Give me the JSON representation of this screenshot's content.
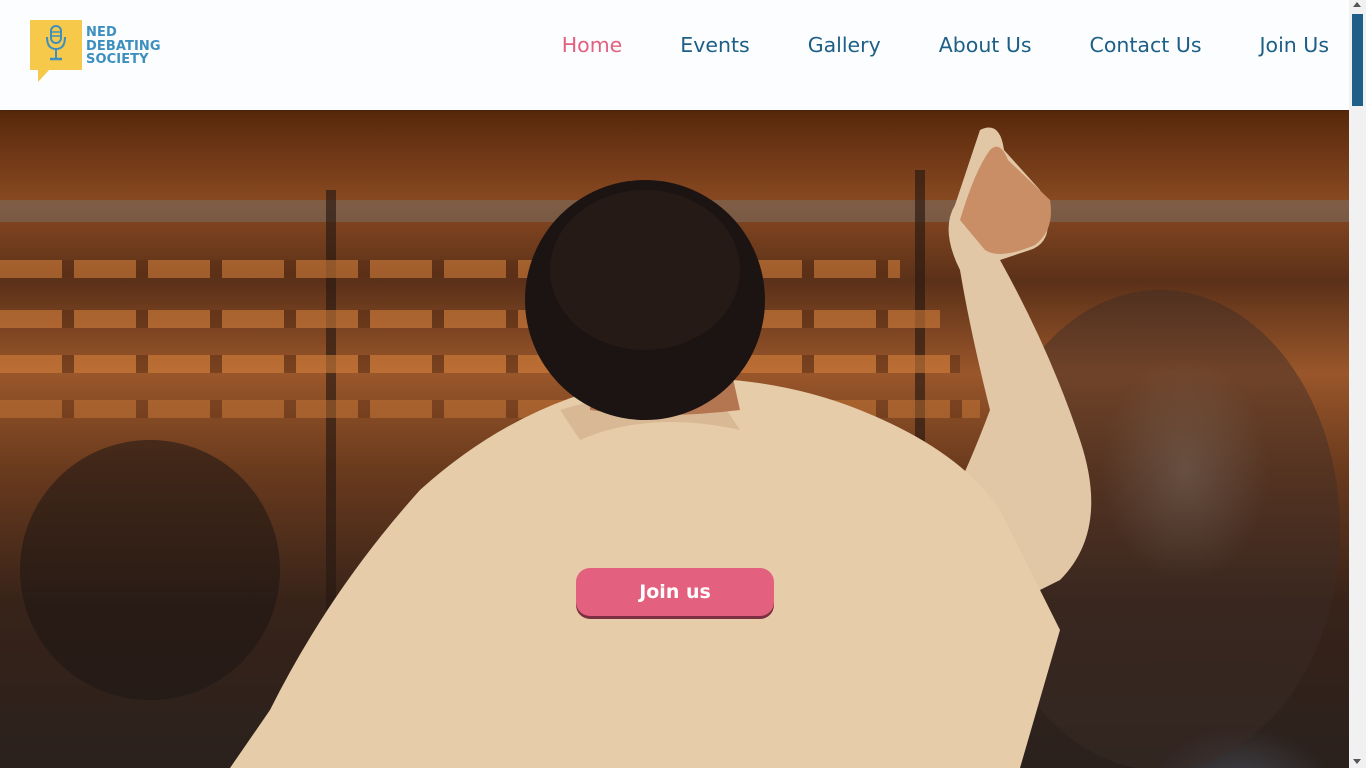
{
  "brand": {
    "logo_lines": [
      "NED",
      "DEBATING",
      "SOCIETY"
    ],
    "logo_icon": "microphone-icon",
    "colors": {
      "logo_yellow": "#f6c94b",
      "logo_blue": "#3d8fc0"
    }
  },
  "nav": {
    "items": [
      {
        "label": "Home",
        "active": true
      },
      {
        "label": "Events",
        "active": false
      },
      {
        "label": "Gallery",
        "active": false
      },
      {
        "label": "About Us",
        "active": false
      },
      {
        "label": "Contact Us",
        "active": false
      },
      {
        "label": "Join Us",
        "active": false
      }
    ],
    "colors": {
      "default": "#1d5f86",
      "active": "#e3607f"
    }
  },
  "hero": {
    "cta_label": "Join us",
    "cta_color": "#e3607f"
  },
  "scrollbar": {
    "thumb_color": "#1d5f86"
  }
}
